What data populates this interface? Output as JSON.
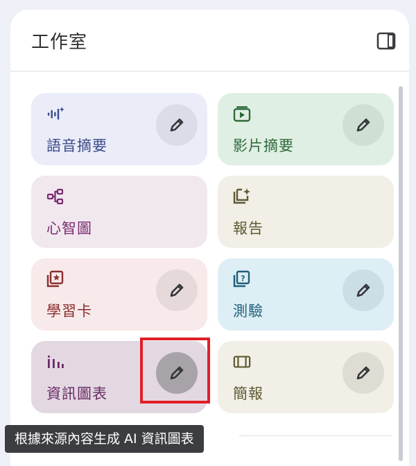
{
  "panel": {
    "title": "工作室",
    "toggle_icon": "side-panel-icon"
  },
  "cards": [
    {
      "label": "語音摘要",
      "icon": "audio-waveform-sparkle-icon",
      "bg": "#eaedf8",
      "text_color": "#3c4a8a",
      "icon_color": "#3c4a8a",
      "edit": true,
      "btn_bg": "#dadde8"
    },
    {
      "label": "影片摘要",
      "icon": "video-play-icon",
      "bg": "#e0efe4",
      "text_color": "#2f6a3a",
      "icon_color": "#2f6a3a",
      "edit": true,
      "btn_bg": "#cfdfd3"
    },
    {
      "label": "心智圖",
      "icon": "mind-map-icon",
      "bg": "#f1e8ef",
      "text_color": "#7a2c6e",
      "icon_color": "#7a2c6e",
      "edit": false
    },
    {
      "label": "報告",
      "icon": "report-sparkle-icon",
      "bg": "#f1efe6",
      "text_color": "#5f5a33",
      "icon_color": "#5f5a33",
      "edit": false
    },
    {
      "label": "學習卡",
      "icon": "flashcards-icon",
      "bg": "#f8eaea",
      "text_color": "#8a2f2f",
      "icon_color": "#8a2f2f",
      "edit": true,
      "btn_bg": "#e6d9d9"
    },
    {
      "label": "測驗",
      "icon": "quiz-icon",
      "bg": "#ddeef5",
      "text_color": "#1f5f7a",
      "icon_color": "#1f5f7a",
      "edit": true,
      "btn_bg": "#cbdde5"
    },
    {
      "label": "資訊圖表",
      "icon": "infographic-icon",
      "bg": "#e3d8e2",
      "text_color": "#6a2a64",
      "icon_color": "#6a2a64",
      "edit": true,
      "btn_bg": "#a8a3a8"
    },
    {
      "label": "簡報",
      "icon": "slides-icon",
      "bg": "#f1efe6",
      "text_color": "#5f5a33",
      "icon_color": "#5f5a33",
      "edit": true,
      "btn_bg": "#dfddd3"
    }
  ],
  "tooltip": {
    "text": "根據來源內容生成 AI 資訊圖表"
  },
  "colors": {
    "background": "#eef0f7",
    "panel": "#ffffff",
    "highlight": "#e01f26",
    "tooltip_bg": "#3c3d40"
  }
}
